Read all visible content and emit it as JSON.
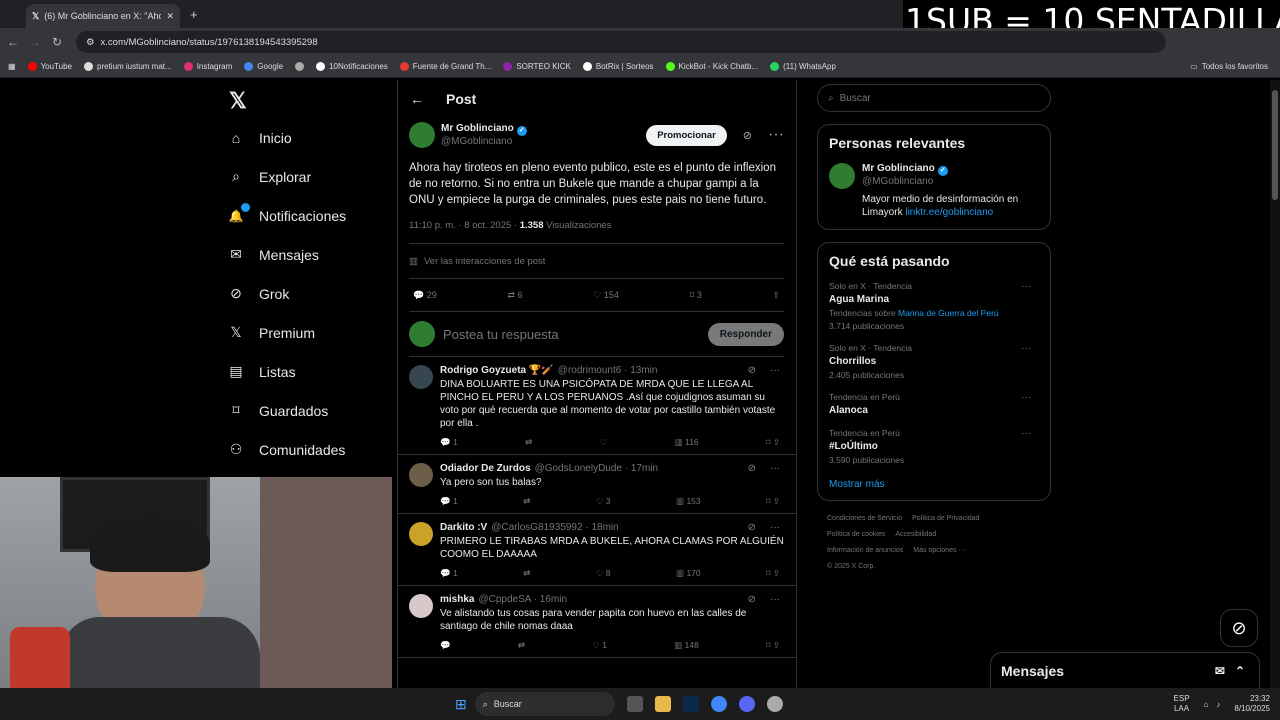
{
  "browser": {
    "tab_title": "(6) Mr Goblinciano en X: \"Ahora",
    "url": "x.com/MGoblinciano/status/1976138194543395298",
    "bookmarks": [
      {
        "label": "YouTube",
        "color": "#ff0000"
      },
      {
        "label": "pretium iustum mat...",
        "color": "#dddddd"
      },
      {
        "label": "Instagram",
        "color": "#e1306c"
      },
      {
        "label": "Google",
        "color": "#4285f4"
      },
      {
        "label": "",
        "color": "#aaaaaa"
      },
      {
        "label": "10Notificaciones",
        "color": "#ffffff"
      },
      {
        "label": "Fuente de Grand Th...",
        "color": "#e53935"
      },
      {
        "label": "SORTEO KICK",
        "color": "#8e24aa"
      },
      {
        "label": "BotRix | Sorteos",
        "color": "#ffffff"
      },
      {
        "label": "KickBot - Kick Chatb...",
        "color": "#53fc18"
      },
      {
        "label": "(11) WhatsApp",
        "color": "#25d366"
      }
    ],
    "all_bookmarks": "Todos los favoritos"
  },
  "stream_overlay": "1SUB = 10 SENTADILLA",
  "nav": {
    "items": [
      {
        "label": "Inicio",
        "icon": "home-icon"
      },
      {
        "label": "Explorar",
        "icon": "search-icon"
      },
      {
        "label": "Notificaciones",
        "icon": "bell-icon"
      },
      {
        "label": "Mensajes",
        "icon": "mail-icon"
      },
      {
        "label": "Grok",
        "icon": "grok-icon"
      },
      {
        "label": "Premium",
        "icon": "x-icon"
      },
      {
        "label": "Listas",
        "icon": "list-icon"
      },
      {
        "label": "Guardados",
        "icon": "bookmark-icon"
      },
      {
        "label": "Comunidades",
        "icon": "people-icon"
      }
    ]
  },
  "post": {
    "header": "Post",
    "author": "Mr Goblinciano",
    "handle": "@MGoblinciano",
    "promote": "Promocionar",
    "text": "Ahora hay tiroteos en pleno evento publico, este es el punto de inflexion de no retorno. Si no entra un Bukele que mande a chupar gampi a la ONU y empiece la purga de criminales, pues este pais no tiene futuro.",
    "time": "11:10 p. m. · 8 oct. 2025 · ",
    "views": "1.358",
    "views_label": " Visualizaciones",
    "interactions": "Ver las interacciones de post",
    "replies": "29",
    "reposts": "6",
    "likes": "154",
    "bookmarks": "3",
    "reply_placeholder": "Postea tu respuesta",
    "reply_button": "Responder"
  },
  "comments": [
    {
      "name": "Rodrigo Goyzueta 🏆🏏",
      "handle": "@rodrimount6 · 13min",
      "text": "DINA BOLUARTE ES UNA PSICÓPATA DE MRDA QUE LE LLEGA AL PINCHO EL PERU Y A LOS PERUANOS  .Así que cojudignos asuman su voto por qué recuerda que al momento de votar por castillo también votaste por ella .",
      "replies": "1",
      "reposts": "",
      "likes": "",
      "views": "116",
      "avatar": "#37474f"
    },
    {
      "name": "Odiador De Zurdos",
      "handle": "@GodsLonelyDude · 17min",
      "text": "Ya pero son tus balas?",
      "replies": "1",
      "reposts": "",
      "likes": "3",
      "views": "153",
      "avatar": "#6d5e4a"
    },
    {
      "name": "Darkito :V",
      "handle": "@CarlosG81935992 · 18min",
      "text": "PRIMERO LE TIRABAS MRDA A BUKELE, AHORA CLAMAS POR ALGUIÉN COOMO EL DAAAAA",
      "replies": "1",
      "reposts": "",
      "likes": "8",
      "views": "170",
      "avatar": "#c9a227"
    },
    {
      "name": "mishka",
      "handle": "@CppdeSA · 16min",
      "text": "Ve alistando tus cosas para vender papita con huevo en las calles de santiago de chile nomas daaa",
      "replies": "",
      "reposts": "",
      "likes": "1",
      "views": "148",
      "avatar": "#d7c9c9"
    }
  ],
  "right": {
    "search_placeholder": "Buscar",
    "relevant_title": "Personas relevantes",
    "rel_name": "Mr Goblinciano",
    "rel_handle": "@MGoblinciano",
    "rel_bio": "Mayor medio de desinformación en Limayork ",
    "rel_link": "linktr.ee/goblinciano",
    "trending_title": "Qué está pasando",
    "trends": [
      {
        "cat": "Solo en X · Tendencia",
        "title": "Agua Marina",
        "extra": "Tendencias sobre ",
        "extra_link": "Marina de Guerra del Perú",
        "count": "3.714 publicaciones"
      },
      {
        "cat": "Solo en X · Tendencia",
        "title": "Chorrillos",
        "extra": "",
        "extra_link": "",
        "count": "2.405 publicaciones"
      },
      {
        "cat": "Tendencia en Perú",
        "title": "Alanoca",
        "extra": "",
        "extra_link": "",
        "count": ""
      },
      {
        "cat": "Tendencia en Perú",
        "title": "#LoÚltimo",
        "extra": "",
        "extra_link": "",
        "count": "3.590 publicaciones"
      }
    ],
    "show_more": "Mostrar más",
    "footer": [
      "Condiciones de Servicio",
      "Política de Privacidad",
      "Política de cookies",
      "Accesibilidad",
      "Información de anuncios",
      "Más opciones ···",
      "© 2025 X Corp."
    ]
  },
  "messages_label": "Mensajes",
  "taskbar": {
    "search": "Buscar",
    "lang1": "ESP",
    "lang2": "LAA",
    "time": "23:32",
    "date": "8/10/2025"
  }
}
